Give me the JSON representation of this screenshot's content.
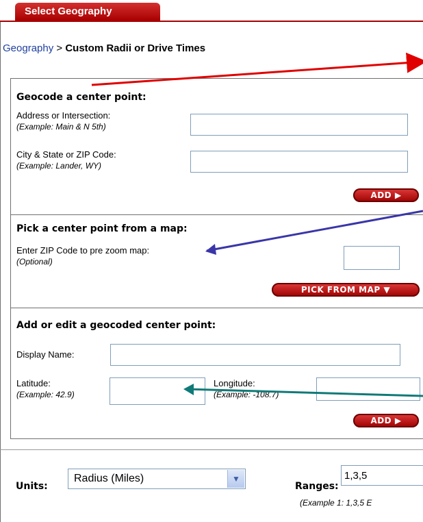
{
  "tab": {
    "label": "Select Geography"
  },
  "breadcrumb": {
    "link": "Geography",
    "separator": " > ",
    "current": "Custom Radii or Drive Times"
  },
  "geocode": {
    "heading": "Geocode a center point:",
    "address_label": "Address or Intersection:",
    "address_example": "(Example: Main & N 5th)",
    "address_value": "",
    "city_label": "City & State or ZIP Code:",
    "city_example": "(Example: Lander, WY)",
    "city_value": "",
    "add_button": "ADD ▶"
  },
  "pick": {
    "heading": "Pick a center point from a map:",
    "zip_label": "Enter ZIP Code to pre zoom map:",
    "zip_note": "(Optional)",
    "zip_value": "",
    "pick_button": "PICK FROM MAP ▼"
  },
  "edit": {
    "heading": "Add or edit a geocoded center point:",
    "display_name_label": "Display Name:",
    "display_name_value": "",
    "latitude_label": "Latitude:",
    "latitude_example": "(Example: 42.9)",
    "latitude_value": "",
    "longitude_label": "Longitude:",
    "longitude_example": "(Example: -108.7)",
    "longitude_value": "",
    "add_button": "ADD ▶"
  },
  "settings": {
    "units_label": "Units:",
    "units_value": "Radius (Miles)",
    "ranges_label": "Ranges:",
    "ranges_value": "1,3,5",
    "ranges_example": "(Example 1:  1,3,5   E"
  },
  "colors": {
    "tab": "#b00000",
    "button": "#c00000",
    "arrow_red": "#e00000",
    "arrow_blue": "#3a36a8",
    "arrow_teal": "#0f7a78"
  }
}
